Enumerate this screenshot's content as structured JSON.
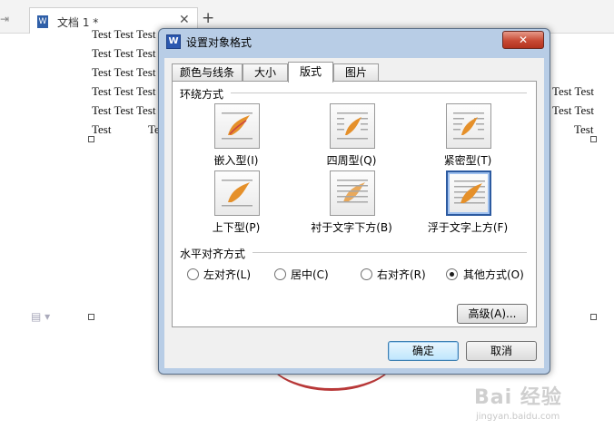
{
  "editor": {
    "tab_title": "文档 1 *",
    "tab_close": "✕",
    "tab_add": "+",
    "history_arrow": "⇥",
    "lines": [
      "Test Test Test",
      "Test Test Test",
      "Test Test Test",
      "Test Test Test",
      "Test Test Test",
      "Test",
      "Tes"
    ],
    "right_lines": [
      "Test Test",
      "Test Test",
      "Test"
    ]
  },
  "watermark": {
    "main": "Bai 经验",
    "sub": "jingyan.baidu.com"
  },
  "dialog": {
    "title": "设置对象格式",
    "close": "✕",
    "tabs": [
      {
        "label": "颜色与线条"
      },
      {
        "label": "大小"
      },
      {
        "label": "版式"
      },
      {
        "label": "图片"
      }
    ],
    "active_tab": "版式",
    "wrap_section": "环绕方式",
    "wrap_options": [
      {
        "label": "嵌入型(I)",
        "icon": "inline-wrap-icon",
        "selected": false
      },
      {
        "label": "四周型(Q)",
        "icon": "square-wrap-icon",
        "selected": false
      },
      {
        "label": "紧密型(T)",
        "icon": "tight-wrap-icon",
        "selected": false
      },
      {
        "label": "上下型(P)",
        "icon": "top-bottom-wrap-icon",
        "selected": false
      },
      {
        "label": "衬于文字下方(B)",
        "icon": "behind-text-icon",
        "selected": false
      },
      {
        "label": "浮于文字上方(F)",
        "icon": "in-front-text-icon",
        "selected": true
      }
    ],
    "align_section": "水平对齐方式",
    "align_options": [
      {
        "label": "左对齐(L)",
        "checked": false
      },
      {
        "label": "居中(C)",
        "checked": false
      },
      {
        "label": "右对齐(R)",
        "checked": false
      },
      {
        "label": "其他方式(O)",
        "checked": true
      }
    ],
    "advanced_button": "高级(A)...",
    "ok_button": "确定",
    "cancel_button": "取消"
  },
  "colors": {
    "accent": "#2c5aa0",
    "picture_flame": "#e5902a",
    "picture_frame": "#a7a7a7",
    "dialog_frame": "#b8cde6"
  }
}
